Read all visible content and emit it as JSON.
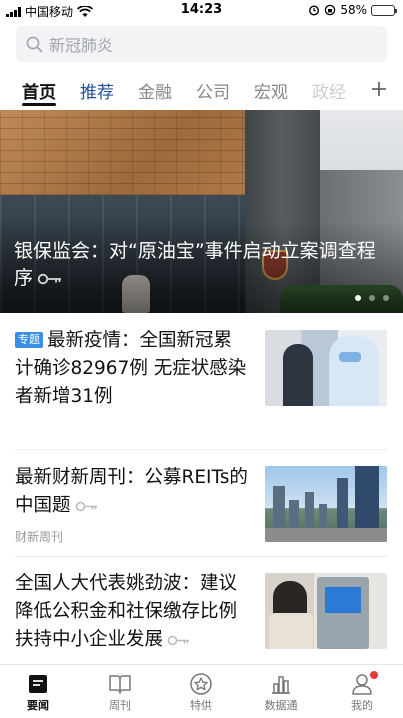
{
  "status_bar": {
    "carrier": "中国移动",
    "time": "14:23",
    "battery": "58%",
    "battery_level": 0.58
  },
  "search": {
    "placeholder": "新冠肺炎"
  },
  "tabs": [
    {
      "label": "首页",
      "active": true
    },
    {
      "label": "推荐"
    },
    {
      "label": "金融"
    },
    {
      "label": "公司"
    },
    {
      "label": "宏观"
    },
    {
      "label": "政经"
    }
  ],
  "add_tab_icon": "plus-icon",
  "hero": {
    "title": "银保监会：对“原油宝”事件启动立案调查程序",
    "slide_count": 3,
    "active_slide": 1
  },
  "articles": [
    {
      "tag": "专题",
      "title": "最新疫情：全国新冠累计确诊82967例 无症状感染者新增31例",
      "source": "",
      "thumbnail": "medical-test-photo"
    },
    {
      "tag": "",
      "title": "最新财新周刊：公募REITs的中国题",
      "source": "财新周刊",
      "thumbnail": "city-skyline-photo"
    },
    {
      "tag": "",
      "title": "全国人大代表姚劲波：建议降低公积金和社保缴存比例扶持中小企业发展",
      "source": "",
      "thumbnail": "atm-photo"
    }
  ],
  "bottom_nav": [
    {
      "label": "要闻",
      "icon": "news-icon",
      "active": true
    },
    {
      "label": "周刊",
      "icon": "book-icon"
    },
    {
      "label": "特供",
      "icon": "star-badge-icon"
    },
    {
      "label": "数据通",
      "icon": "chart-icon"
    },
    {
      "label": "我的",
      "icon": "user-icon",
      "has_badge": true
    }
  ],
  "colors": {
    "accent_blue": "#1f4fa3",
    "tag_blue": "#3a8ee6",
    "battery_yellow": "#f5c400",
    "badge_red": "#e53935"
  }
}
